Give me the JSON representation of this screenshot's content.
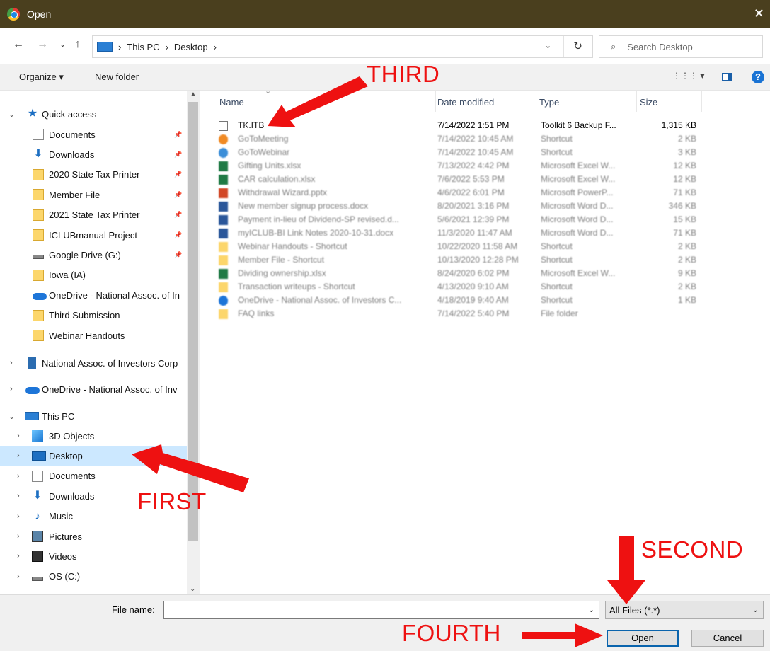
{
  "window": {
    "title": "Open",
    "close": "✕"
  },
  "address": {
    "back": "←",
    "forward": "→",
    "recent": "⌄",
    "up": "↑",
    "crumbs": [
      "This PC",
      "Desktop"
    ],
    "separator": "›",
    "dropdown": "⌄",
    "refresh": "↻",
    "search_placeholder": "Search Desktop"
  },
  "toolbar": {
    "organize": "Organize ▾",
    "new_folder": "New folder",
    "views": "⋮⋮⋮ ▾",
    "help": "?"
  },
  "nav": {
    "quick_access": "Quick access",
    "items": [
      {
        "label": "Documents",
        "icon": "doc"
      },
      {
        "label": "Downloads",
        "icon": "download"
      },
      {
        "label": "2020 State Tax Printer",
        "icon": "folder"
      },
      {
        "label": "Member File",
        "icon": "folder"
      },
      {
        "label": "2021 State Tax Printer",
        "icon": "folder"
      },
      {
        "label": "ICLUBmanual Project",
        "icon": "folder"
      },
      {
        "label": "Google Drive (G:)",
        "icon": "drive"
      },
      {
        "label": "Iowa (IA)",
        "icon": "folder"
      },
      {
        "label": "OneDrive - National Assoc. of In",
        "icon": "cloud"
      },
      {
        "label": "Third Submission",
        "icon": "folder"
      },
      {
        "label": "Webinar Handouts",
        "icon": "folder"
      }
    ],
    "national": "National Assoc. of Investors Corp",
    "onedrive": "OneDrive - National Assoc. of Inv",
    "this_pc": "This PC",
    "pc_items": [
      {
        "label": "3D Objects",
        "icon": "3d"
      },
      {
        "label": "Desktop",
        "icon": "desktop"
      },
      {
        "label": "Documents",
        "icon": "doc"
      },
      {
        "label": "Downloads",
        "icon": "download"
      },
      {
        "label": "Music",
        "icon": "music"
      },
      {
        "label": "Pictures",
        "icon": "pictures"
      },
      {
        "label": "Videos",
        "icon": "videos"
      },
      {
        "label": "OS (C:)",
        "icon": "drive"
      }
    ]
  },
  "columns": {
    "name": "Name",
    "date": "Date modified",
    "type": "Type",
    "size": "Size"
  },
  "files": [
    {
      "name": "TK.ITB",
      "date": "7/14/2022 1:51 PM",
      "type": "Toolkit 6 Backup F...",
      "size": "1,315 KB",
      "icon": "doc"
    },
    {
      "name": "GoToMeeting",
      "date": "7/14/2022 10:45 AM",
      "type": "Shortcut",
      "size": "2 KB",
      "icon": "shortcut-orange"
    },
    {
      "name": "GoToWebinar",
      "date": "7/14/2022 10:45 AM",
      "type": "Shortcut",
      "size": "3 KB",
      "icon": "shortcut-blue"
    },
    {
      "name": "Gifting Units.xlsx",
      "date": "7/13/2022 4:42 PM",
      "type": "Microsoft Excel W...",
      "size": "12 KB",
      "icon": "excel"
    },
    {
      "name": "CAR calculation.xlsx",
      "date": "7/6/2022 5:53 PM",
      "type": "Microsoft Excel W...",
      "size": "12 KB",
      "icon": "excel"
    },
    {
      "name": "Withdrawal Wizard.pptx",
      "date": "4/6/2022 6:01 PM",
      "type": "Microsoft PowerP...",
      "size": "71 KB",
      "icon": "ppt"
    },
    {
      "name": "New member signup process.docx",
      "date": "8/20/2021 3:16 PM",
      "type": "Microsoft Word D...",
      "size": "346 KB",
      "icon": "word"
    },
    {
      "name": "Payment in-lieu of Dividend-SP revised.d...",
      "date": "5/6/2021 12:39 PM",
      "type": "Microsoft Word D...",
      "size": "15 KB",
      "icon": "word"
    },
    {
      "name": "myICLUB-BI Link Notes 2020-10-31.docx",
      "date": "11/3/2020 11:47 AM",
      "type": "Microsoft Word D...",
      "size": "71 KB",
      "icon": "word"
    },
    {
      "name": "Webinar Handouts - Shortcut",
      "date": "10/22/2020 11:58 AM",
      "type": "Shortcut",
      "size": "2 KB",
      "icon": "folder"
    },
    {
      "name": "Member File - Shortcut",
      "date": "10/13/2020 12:28 PM",
      "type": "Shortcut",
      "size": "2 KB",
      "icon": "folder"
    },
    {
      "name": "Dividing ownership.xlsx",
      "date": "8/24/2020 6:02 PM",
      "type": "Microsoft Excel W...",
      "size": "9 KB",
      "icon": "excel"
    },
    {
      "name": "Transaction writeups - Shortcut",
      "date": "4/13/2020 9:10 AM",
      "type": "Shortcut",
      "size": "2 KB",
      "icon": "folder"
    },
    {
      "name": "OneDrive - National Assoc. of Investors C...",
      "date": "4/18/2019 9:40 AM",
      "type": "Shortcut",
      "size": "1 KB",
      "icon": "cloud"
    },
    {
      "name": "FAQ links",
      "date": "7/14/2022 5:40 PM",
      "type": "File folder",
      "size": "",
      "icon": "folder"
    }
  ],
  "bottom": {
    "file_name_label": "File name:",
    "file_name_value": "",
    "filter": "All Files (*.*)",
    "open": "Open",
    "cancel": "Cancel"
  },
  "annotations": {
    "first": "FIRST",
    "second": "SECOND",
    "third": "THIRD",
    "fourth": "FOURTH"
  },
  "colors": {
    "titlebar": "#4a3f1e",
    "selected": "#cce8ff",
    "annotation": "#ee1111",
    "accent": "#0a64ad"
  }
}
